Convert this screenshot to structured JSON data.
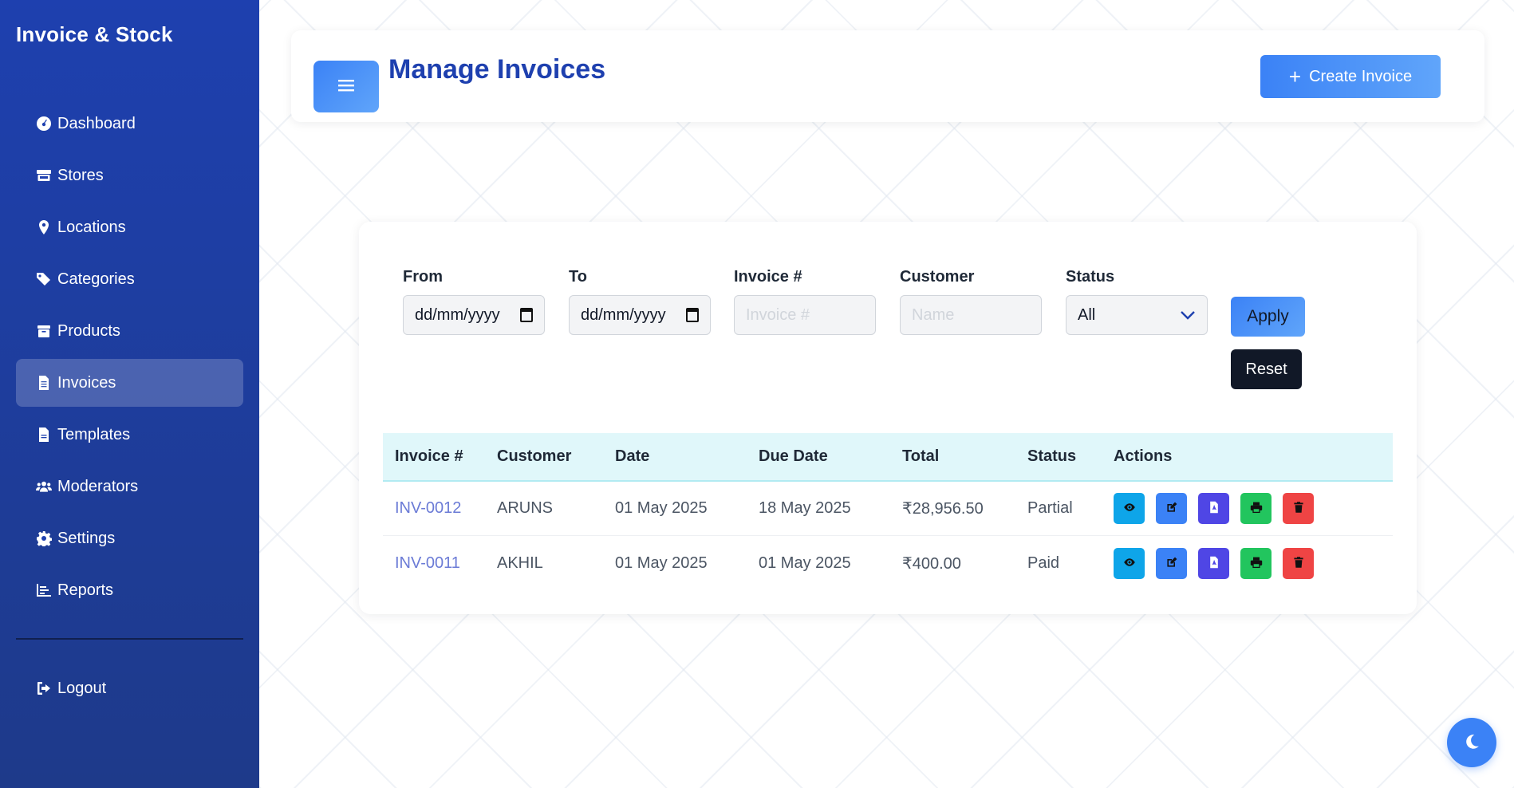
{
  "app": {
    "brand": "Invoice & Stock"
  },
  "sidebar": {
    "items": [
      {
        "label": "Dashboard",
        "icon": "dashboard-icon"
      },
      {
        "label": "Stores",
        "icon": "store-icon"
      },
      {
        "label": "Locations",
        "icon": "location-pin-icon"
      },
      {
        "label": "Categories",
        "icon": "tags-icon"
      },
      {
        "label": "Products",
        "icon": "box-icon"
      },
      {
        "label": "Invoices",
        "icon": "file-invoice-icon",
        "active": true
      },
      {
        "label": "Templates",
        "icon": "file-icon"
      },
      {
        "label": "Moderators",
        "icon": "users-icon"
      },
      {
        "label": "Settings",
        "icon": "gear-icon"
      },
      {
        "label": "Reports",
        "icon": "chart-icon"
      }
    ],
    "logout": {
      "label": "Logout",
      "icon": "logout-icon"
    }
  },
  "header": {
    "title": "Manage Invoices",
    "create_label": "Create Invoice"
  },
  "filters": {
    "from": {
      "label": "From",
      "value": "dd/mm/yyyy"
    },
    "to": {
      "label": "To",
      "value": "dd/mm/yyyy"
    },
    "invoice": {
      "label": "Invoice #",
      "placeholder": "Invoice #"
    },
    "customer": {
      "label": "Customer",
      "placeholder": "Name"
    },
    "status": {
      "label": "Status",
      "value": "All"
    },
    "apply_label": "Apply",
    "reset_label": "Reset"
  },
  "table": {
    "columns": [
      "Invoice #",
      "Customer",
      "Date",
      "Due Date",
      "Total",
      "Status",
      "Actions"
    ],
    "rows": [
      {
        "invoice": "INV-0012",
        "customer": "ARUNS",
        "date": "01 May 2025",
        "due": "18 May 2025",
        "total": "₹28,956.50",
        "status": "Partial"
      },
      {
        "invoice": "INV-0011",
        "customer": "AKHIL",
        "date": "01 May 2025",
        "due": "01 May 2025",
        "total": "₹400.00",
        "status": "Paid"
      }
    ]
  },
  "colors": {
    "sidebar": "#1e40af",
    "accent": "#3b82f6",
    "title": "#1e40af"
  }
}
